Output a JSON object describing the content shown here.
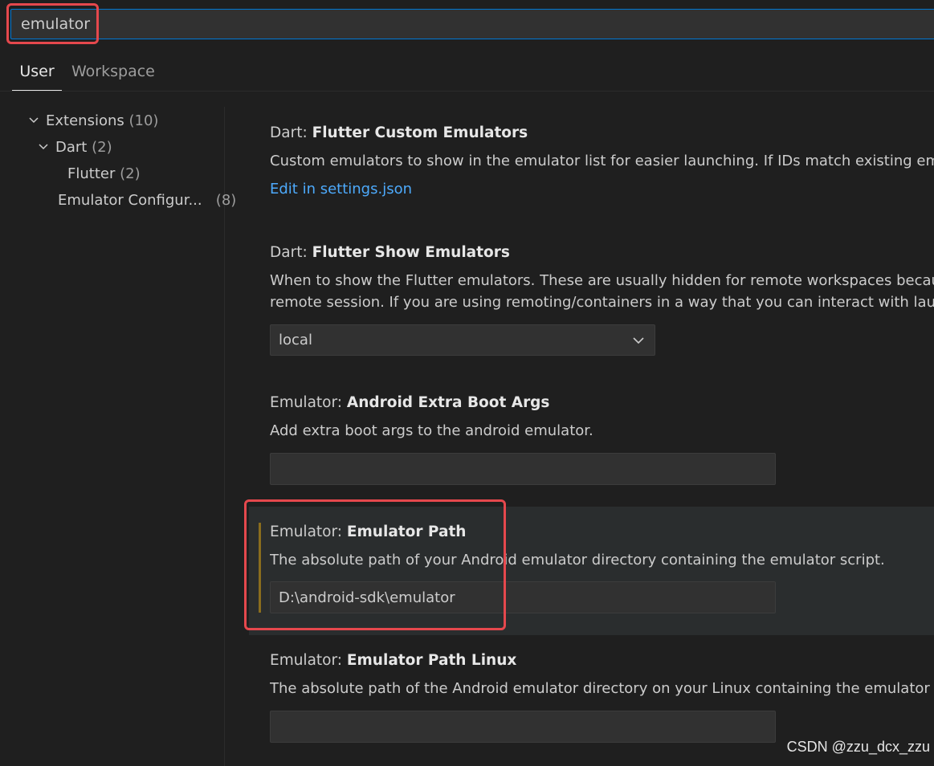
{
  "search": {
    "value": "emulator"
  },
  "tabs": [
    {
      "label": "User"
    },
    {
      "label": "Workspace"
    }
  ],
  "toc": [
    {
      "label": "Extensions",
      "count": "(10)"
    },
    {
      "label": "Dart",
      "count": "(2)"
    },
    {
      "label": "Flutter",
      "count": "(2)"
    },
    {
      "label": "Emulator Configur...",
      "count": "(8)"
    }
  ],
  "settings": {
    "custom_emulators": {
      "category": "Dart: ",
      "name": "Flutter Custom Emulators",
      "description": "Custom emulators to show in the emulator list for easier launching. If IDs match existing emulato",
      "link": "Edit in settings.json"
    },
    "show_emulators": {
      "category": "Dart: ",
      "name": "Flutter Show Emulators",
      "description_1": "When to show the Flutter emulators. These are usually hidden for remote workspaces because it",
      "description_2": "remote session. If you are using remoting/containers in a way that you can interact with launche",
      "selected": "local"
    },
    "extra_boot_args": {
      "category": "Emulator: ",
      "name": "Android Extra Boot Args",
      "description": "Add extra boot args to the android emulator.",
      "value": ""
    },
    "emulator_path": {
      "category": "Emulator: ",
      "name": "Emulator Path",
      "description": "The absolute path of your Android emulator directory containing the emulator script.",
      "value": "D:\\android-sdk\\emulator"
    },
    "emulator_path_linux": {
      "category": "Emulator: ",
      "name": "Emulator Path Linux",
      "description": "The absolute path of the Android emulator directory on your Linux containing the emulator scrip",
      "value": ""
    }
  },
  "watermark": "CSDN @zzu_dcx_zzu",
  "colors": {
    "accent": "#0078d4",
    "link": "#4daafc",
    "highlight": "#e5484d",
    "modified": "#8a6d1e"
  }
}
